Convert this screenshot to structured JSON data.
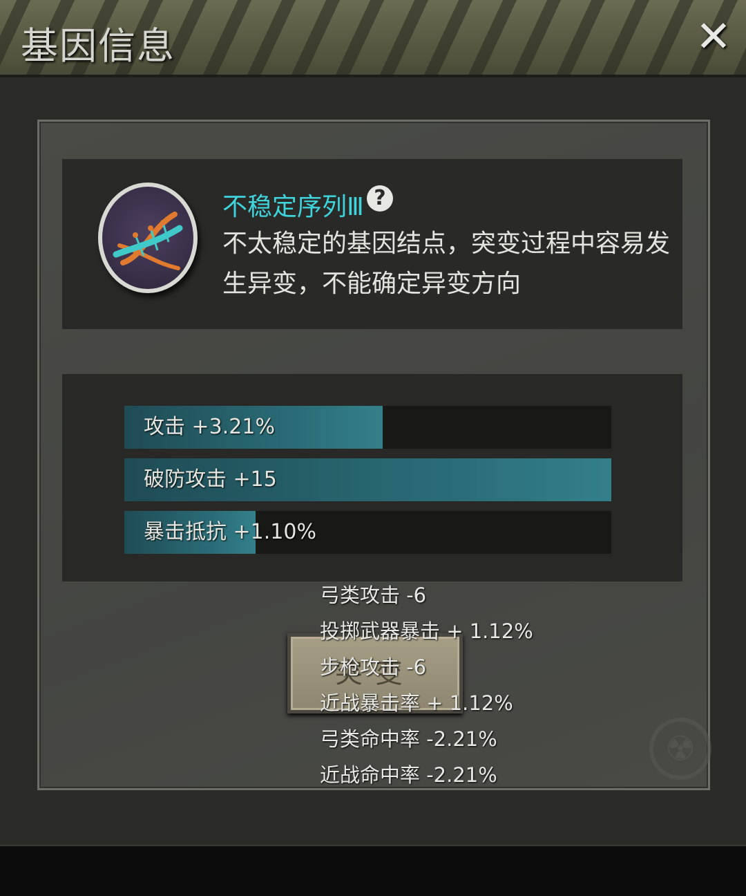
{
  "header": {
    "title": "基因信息",
    "close_label": "✕"
  },
  "gene": {
    "name": "不稳定序列Ⅲ",
    "help_label": "?",
    "description": "不太稳定的基因结点，突变过程中容易发生异变，不能确定异变方向"
  },
  "stats": [
    {
      "label": "攻击 +3.21%",
      "fill": 0.53
    },
    {
      "label": "破防攻击 +15",
      "fill": 1.0
    },
    {
      "label": "暴击抵抗 +1.10%",
      "fill": 0.27
    }
  ],
  "mutate_button": {
    "label": "突变"
  },
  "effects": [
    "弓类攻击 -6",
    "投掷武器暴击 + 1.12%",
    "步枪攻击 -6",
    "近战暴击率 + 1.12%",
    "弓类命中率 -2.21%",
    "近战命中率 -2.21%"
  ],
  "colors": {
    "accent": "#3fd3dc",
    "bar_fill": "#2b6e78",
    "bar_bg": "#181817"
  }
}
